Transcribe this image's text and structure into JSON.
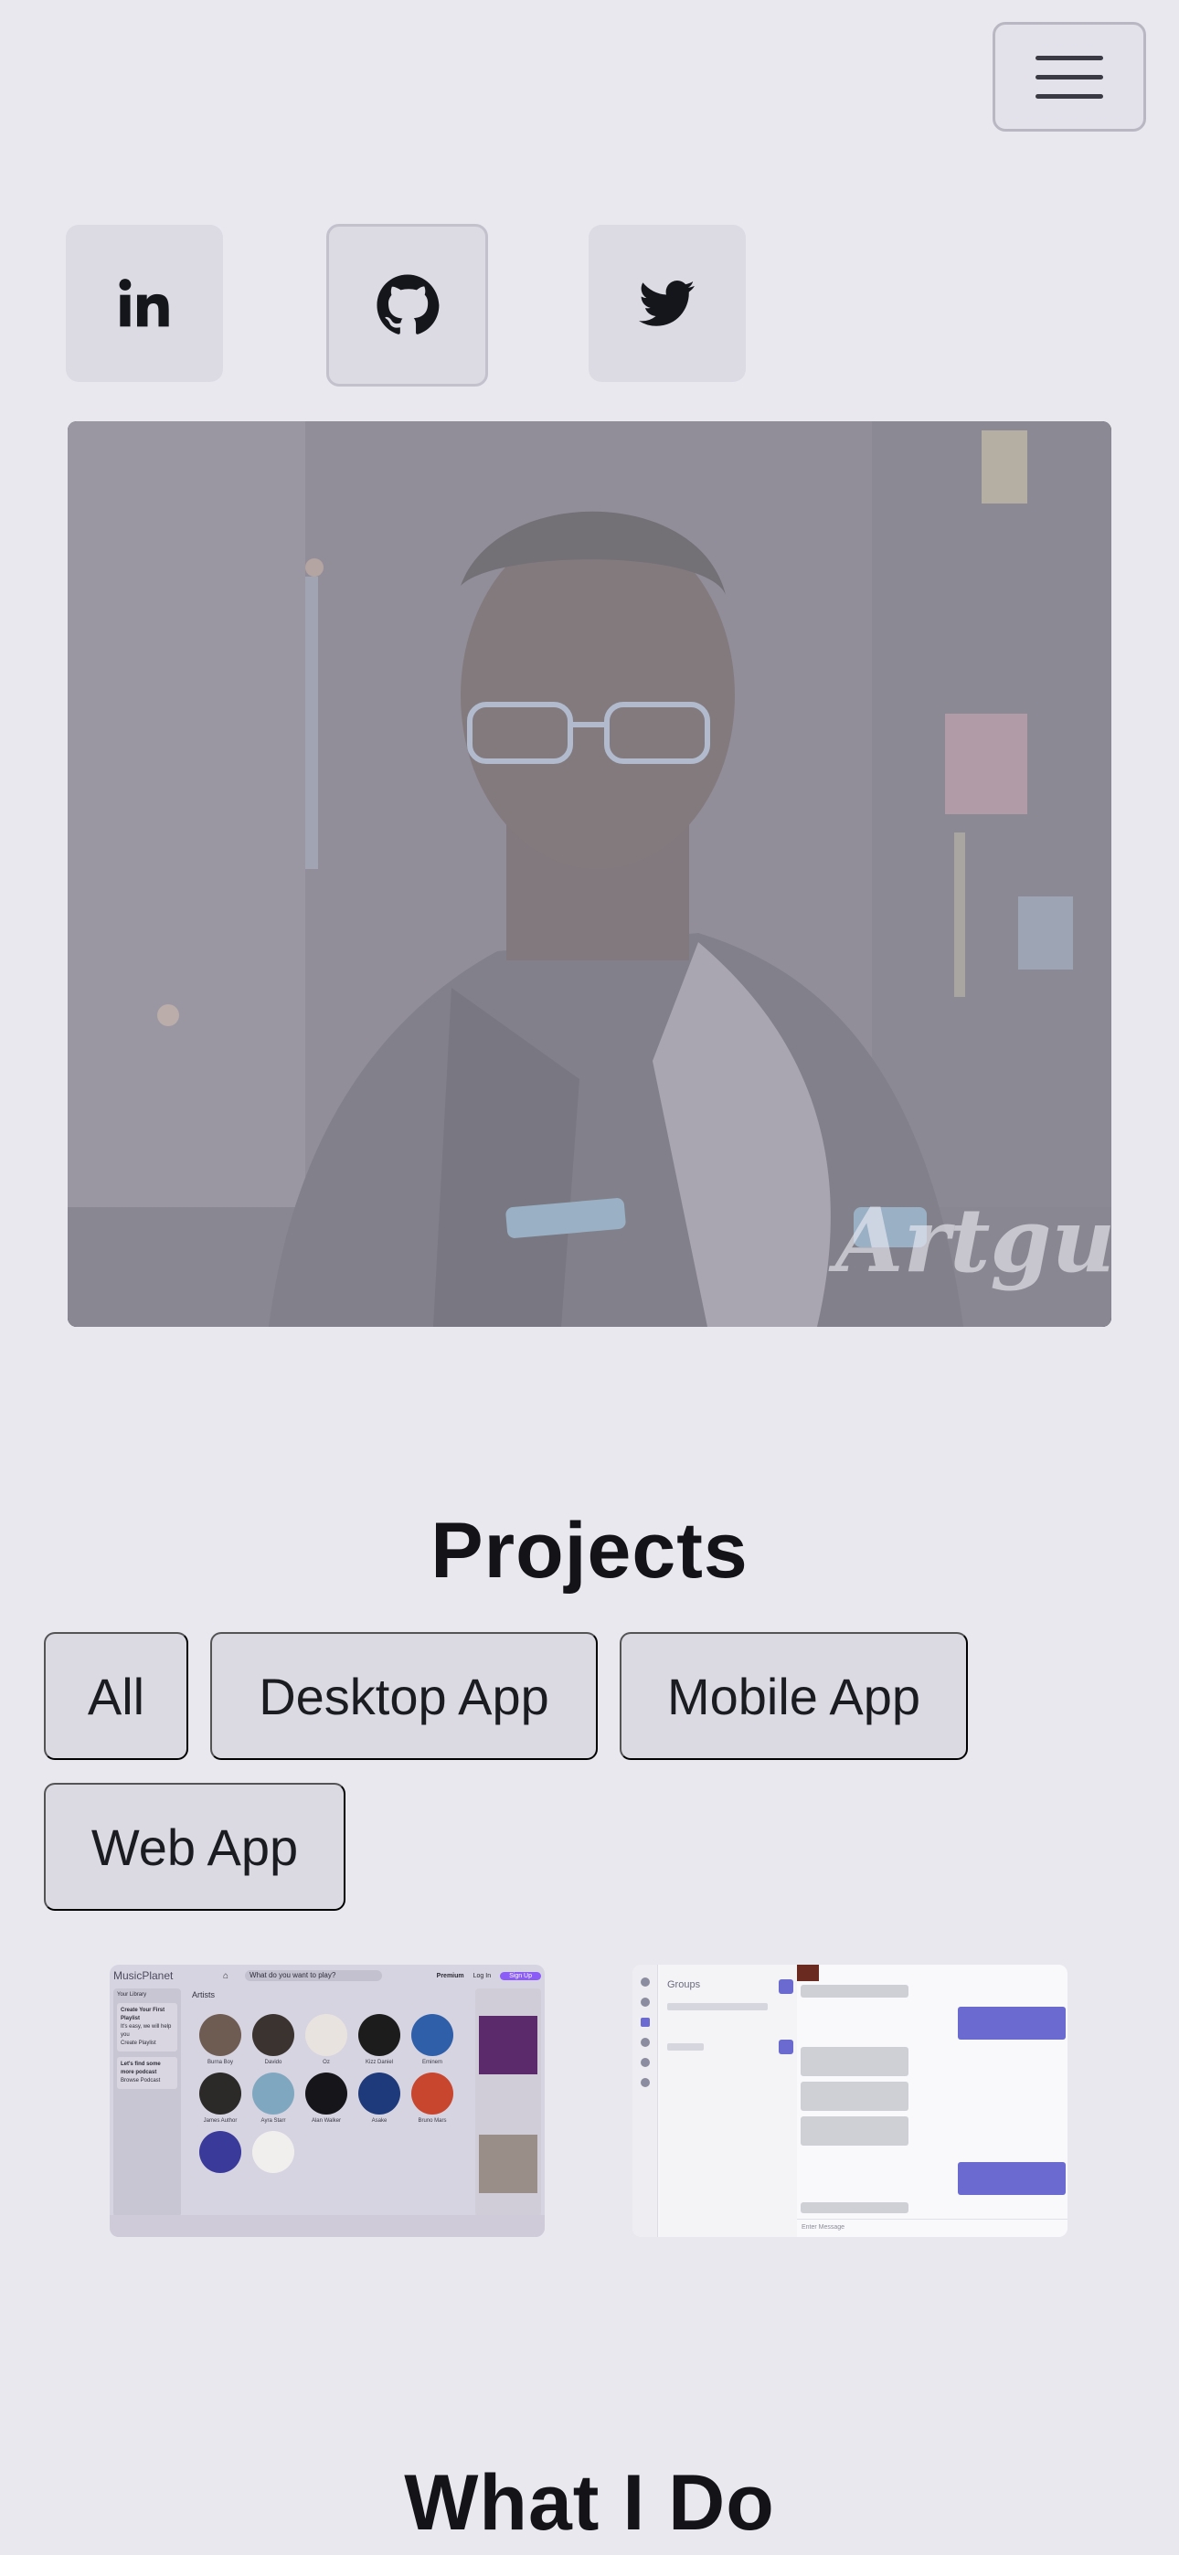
{
  "header": {
    "menu_icon": "hamburger-icon"
  },
  "social": [
    {
      "name": "linkedin",
      "icon": "linkedin-icon"
    },
    {
      "name": "github",
      "icon": "github-icon"
    },
    {
      "name": "twitter",
      "icon": "twitter-icon"
    }
  ],
  "hero": {
    "watermark": "Artguru"
  },
  "projects": {
    "title": "Projects",
    "filters": [
      "All",
      "Desktop App",
      "Mobile App",
      "Web App"
    ],
    "music_app": {
      "logo": "MusicPlanet",
      "search": "What do you want to play?",
      "nav": [
        "Premium",
        "Log In",
        "Sign Up"
      ],
      "artists_heading": "Artists",
      "library": "Your Library",
      "playlist_title": "Create Your First Playlist",
      "playlist_text": "It's easy, we will help you",
      "playlist_button": "Create Playlist",
      "podcast_title": "Let's find some more podcast",
      "podcast_button": "Browse Podcast",
      "artists": [
        "Burna Boy",
        "Davido",
        "Oz",
        "Kizz Daniel",
        "Eminem",
        "James Author",
        "Ayra Starr",
        "Alan Walker",
        "Asake",
        "Bruno Mars"
      ]
    },
    "chat_app": {
      "groups_title": "Groups",
      "input_placeholder": "Enter Message"
    }
  },
  "what_i_do": {
    "title": "What I Do"
  },
  "colors": {
    "background": "#e9e8ef",
    "button": "#dcdbe4",
    "text": "#15151c",
    "accent": "#6b6ad0"
  }
}
